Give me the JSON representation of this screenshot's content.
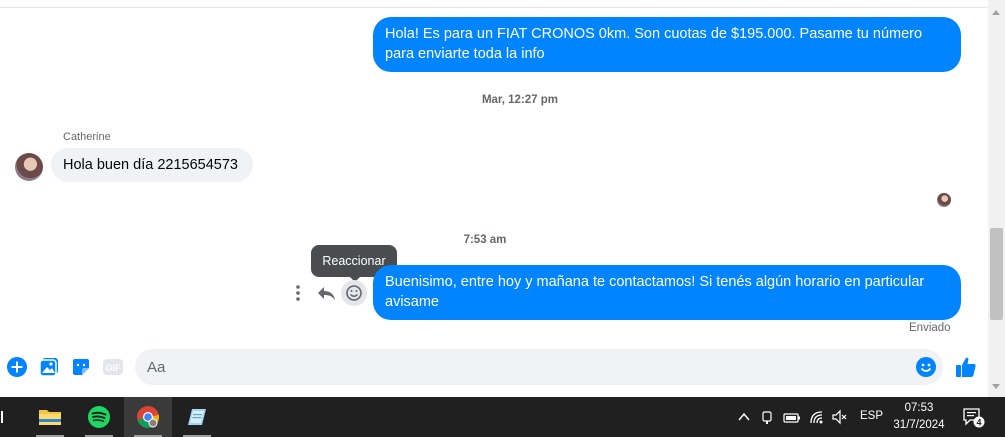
{
  "conversation": {
    "messages": [
      {
        "id": "m1",
        "direction": "outgoing",
        "text": "Hola! Es para un FIAT CRONOS 0km. Son cuotas de $195.000. Pasame tu número para enviarte toda la info"
      },
      {
        "id": "ts1",
        "type": "timestamp",
        "text": "Mar, 12:27 pm"
      },
      {
        "id": "m2",
        "direction": "incoming",
        "sender": "Catherine",
        "text": "Hola buen día 2215654573"
      },
      {
        "id": "ts2",
        "type": "timestamp",
        "text": "7:53 am"
      },
      {
        "id": "m3",
        "direction": "outgoing",
        "text": "Buenisimo, entre hoy y mañana te contactamos! Si tenés algún horario en particular avisame",
        "status": "Enviado"
      }
    ],
    "tooltip": "Reaccionar",
    "message_actions": [
      "more-icon",
      "reply-icon",
      "react-icon"
    ]
  },
  "composer": {
    "placeholder": "Aa",
    "icons": [
      "add-icon",
      "photo-icon",
      "sticker-icon",
      "gif-icon",
      "emoji-icon",
      "like-icon"
    ],
    "gif_label": "GIF"
  },
  "taskbar": {
    "apps": [
      "file-explorer-icon",
      "spotify-icon",
      "chrome-icon",
      "notepad-icon"
    ],
    "tray": {
      "language": "ESP",
      "time": "07:53",
      "date": "31/7/2024",
      "notifications": "4"
    }
  },
  "colors": {
    "outgoing_bubble": "#0084ff",
    "incoming_bubble": "#f0f2f5",
    "accent": "#0084ff",
    "taskbar": "#202020"
  }
}
